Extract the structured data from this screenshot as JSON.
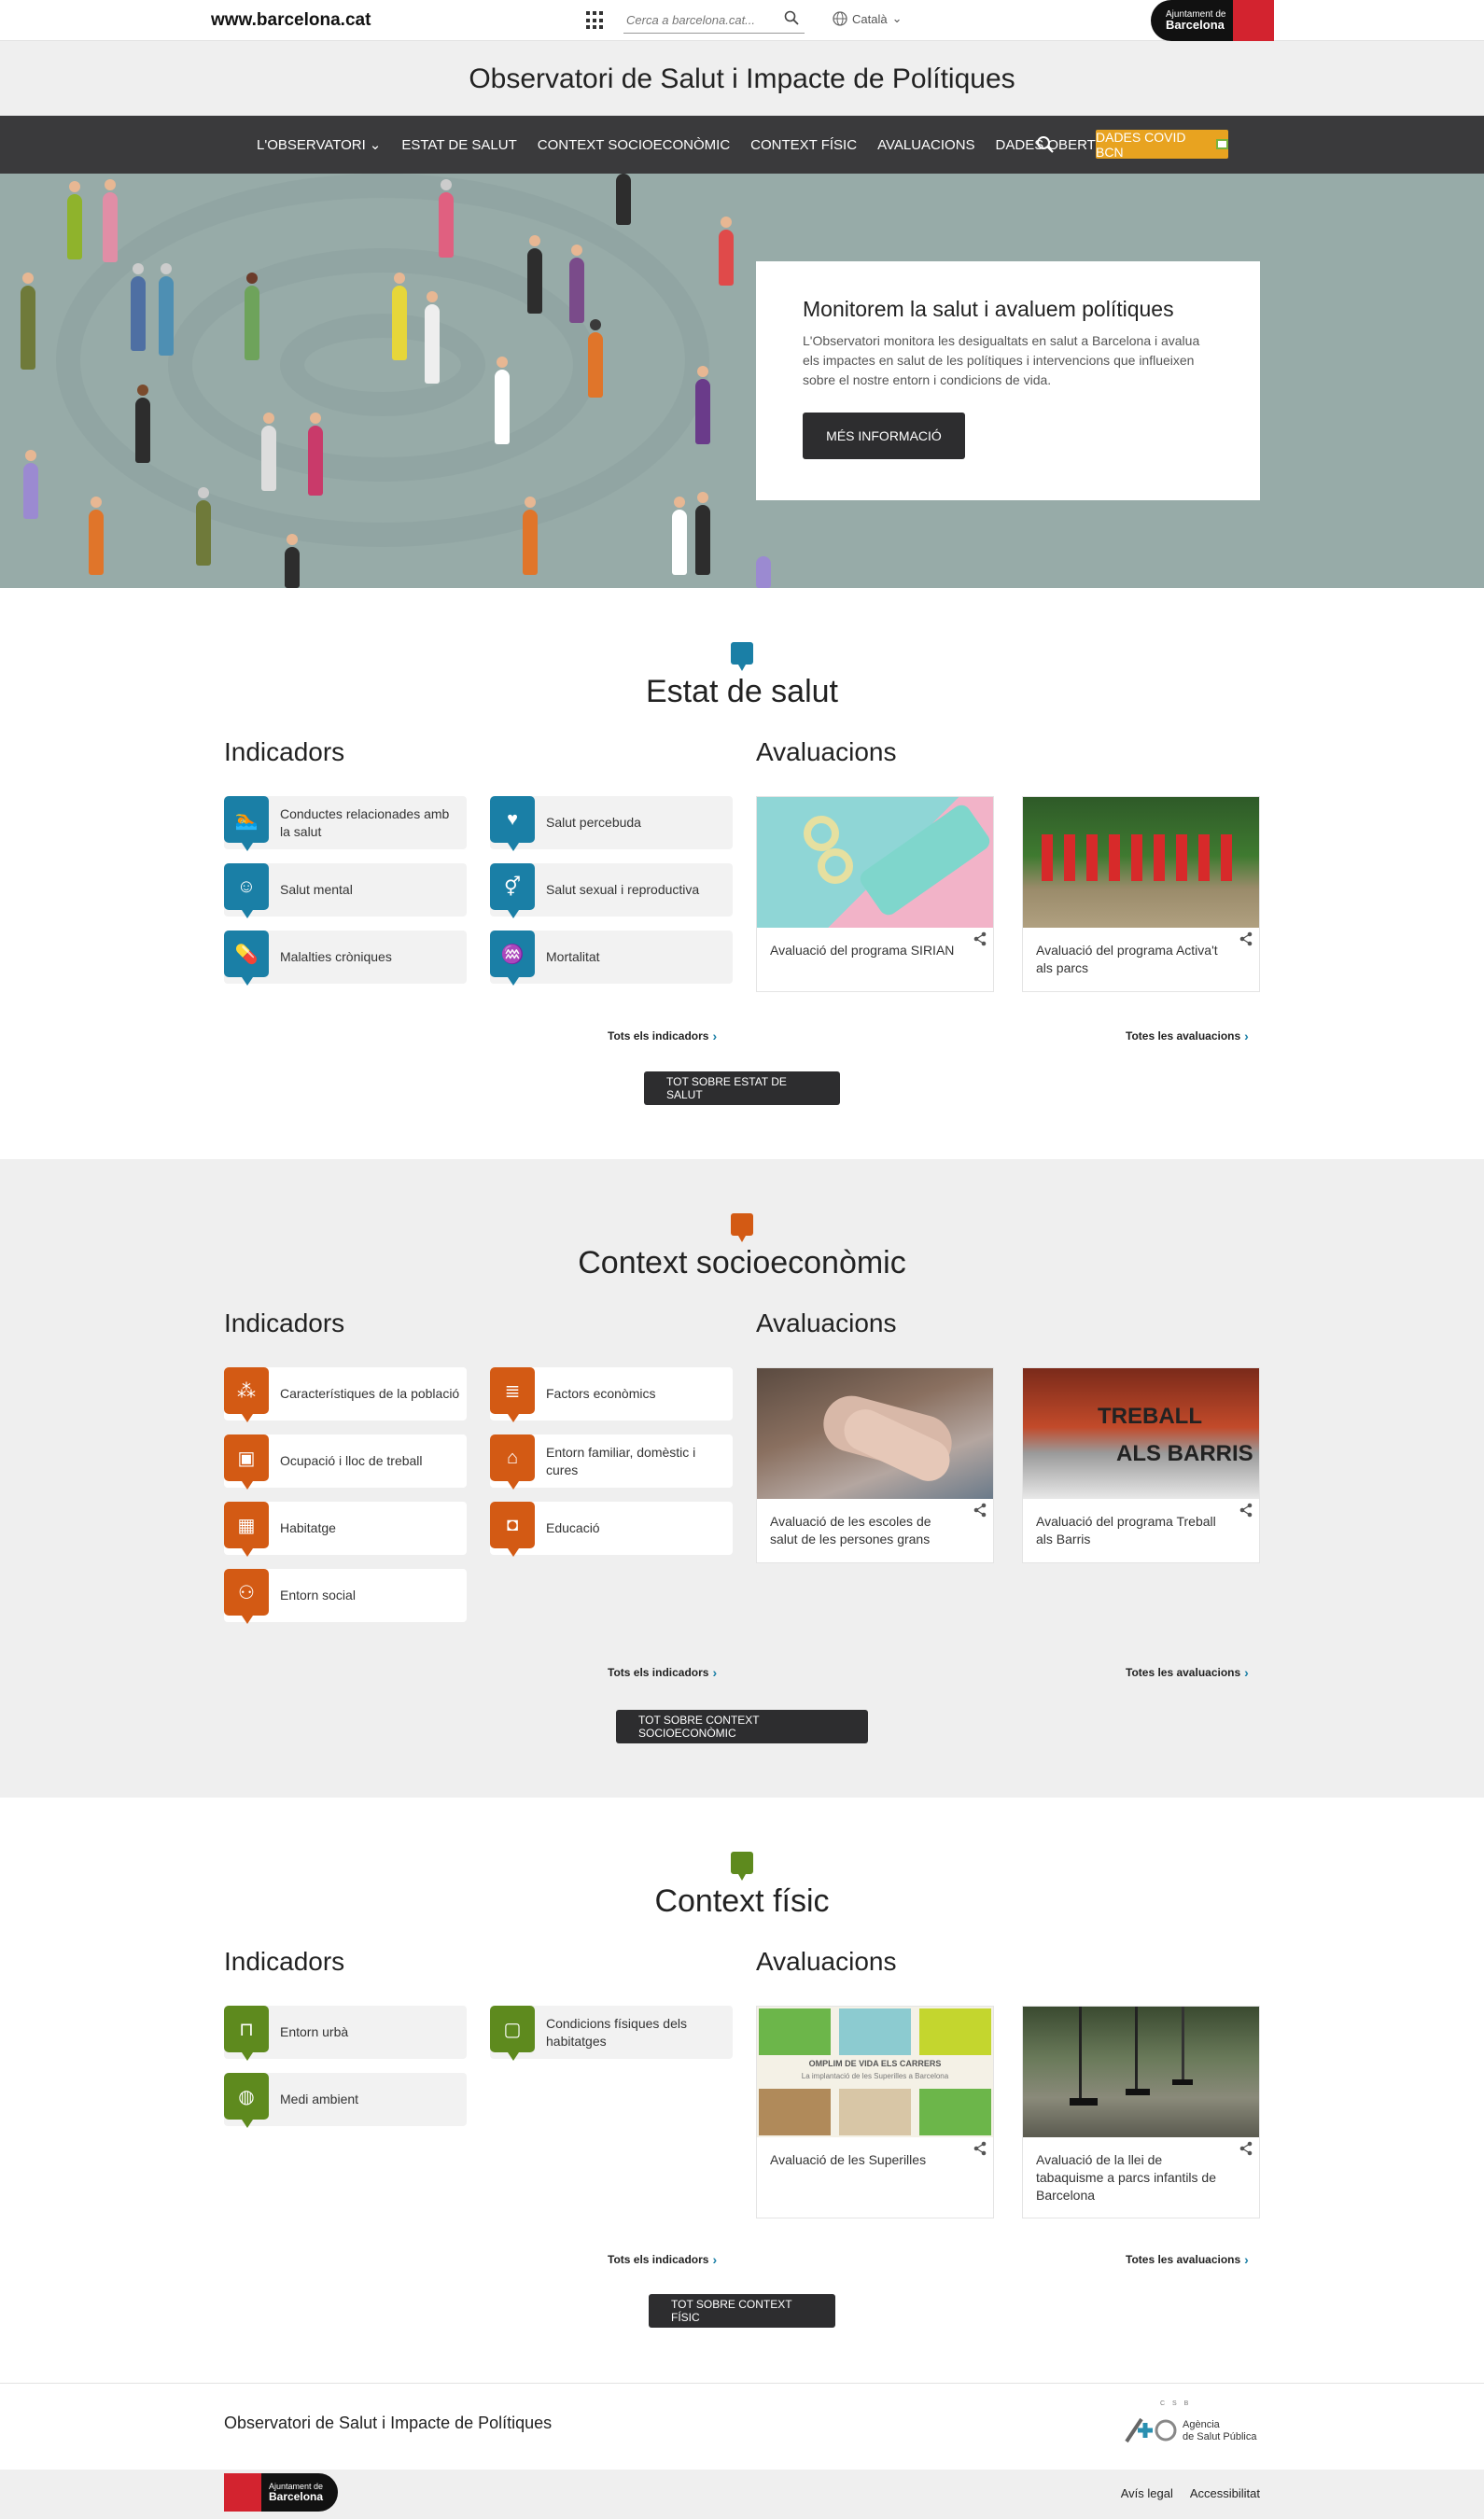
{
  "topbar": {
    "site_url": "www.barcelona.cat",
    "search_placeholder": "Cerca a barcelona.cat...",
    "language": "Català",
    "logo_line1": "Ajuntament de",
    "logo_line2": "Barcelona"
  },
  "site_title": "Observatori de Salut i Impacte de Polítiques",
  "nav": {
    "items": [
      "L'OBSERVATORI",
      "ESTAT DE SALUT",
      "CONTEXT SOCIOECONÒMIC",
      "CONTEXT FÍSIC",
      "AVALUACIONS",
      "DADES OBERTES"
    ],
    "covid_button": "DADES COVID BCN"
  },
  "hero": {
    "title": "Monitorem la salut i avaluem polítiques",
    "text": "L'Observatori monitora les desigualtats en salut a Barcelona i avalua els impactes en salut de les polítiques i intervencions que influeixen sobre el nostre entorn i condicions de vida.",
    "button": "MÉS INFORMACIÓ"
  },
  "colors": {
    "salut": "#1a7fa6",
    "socio": "#d35a14",
    "fisic": "#5e8a1e",
    "nav_bg": "#3a3a3c",
    "covid": "#e8a320"
  },
  "sections": [
    {
      "title": "Estat de salut",
      "indicators_title": "Indicadors",
      "evaluations_title": "Avaluacions",
      "indicators": [
        {
          "label": "Conductes relacionades amb la salut",
          "icon": "swimmer-icon"
        },
        {
          "label": "Salut percebuda",
          "icon": "heart-head-icon"
        },
        {
          "label": "Salut mental",
          "icon": "brain-head-icon"
        },
        {
          "label": "Salut sexual i reproductiva",
          "icon": "gender-icon"
        },
        {
          "label": "Malalties cròniques",
          "icon": "pills-icon"
        },
        {
          "label": "Mortalitat",
          "icon": "ecg-monitor-icon"
        }
      ],
      "evaluations": [
        {
          "label": "Avaluació del programa SIRIAN"
        },
        {
          "label": "Avaluació del programa Activa't als parcs"
        }
      ],
      "all_indicators": "Tots els indicadors",
      "all_evaluations": "Totes les avaluacions",
      "button": "TOT SOBRE ESTAT DE SALUT"
    },
    {
      "title": "Context socioeconòmic",
      "indicators_title": "Indicadors",
      "evaluations_title": "Avaluacions",
      "indicators": [
        {
          "label": "Característiques de la població",
          "icon": "population-pyramid-icon"
        },
        {
          "label": "Factors econòmics",
          "icon": "money-icon"
        },
        {
          "label": "Ocupació i lloc de treball",
          "icon": "briefcase-icon"
        },
        {
          "label": "Entorn familiar, domèstic i cures",
          "icon": "family-house-icon"
        },
        {
          "label": "Habitatge",
          "icon": "building-icon"
        },
        {
          "label": "Educació",
          "icon": "backpack-icon"
        },
        {
          "label": "Entorn social",
          "icon": "community-icon"
        }
      ],
      "evaluations": [
        {
          "label": "Avaluació de les escoles de salut de les persones grans"
        },
        {
          "label": "Avaluació del programa Treball als Barris"
        }
      ],
      "treball_image_text_1": "TREBALL",
      "treball_image_text_2": "ALS BARRIS",
      "all_indicators": "Tots els indicadors",
      "all_evaluations": "Totes les avaluacions",
      "button": "TOT SOBRE CONTEXT SOCIOECONÒMIC"
    },
    {
      "title": "Context físic",
      "indicators_title": "Indicadors",
      "evaluations_title": "Avaluacions",
      "indicators": [
        {
          "label": "Entorn urbà",
          "icon": "bench-icon"
        },
        {
          "label": "Condicions físiques dels habitatges",
          "icon": "window-icon"
        },
        {
          "label": "Medi ambient",
          "icon": "globe-icon"
        }
      ],
      "evaluations": [
        {
          "label": "Avaluació de les Superilles"
        },
        {
          "label": "Avaluació de la llei de tabaquisme a parcs infantils de Barcelona"
        }
      ],
      "superilles_image_text_1": "OMPLIM DE VIDA ELS CARRERS",
      "superilles_image_text_2": "La implantació de les Superilles a Barcelona",
      "all_indicators": "Tots els indicadors",
      "all_evaluations": "Totes les avaluacions",
      "button": "TOT SOBRE CONTEXT FÍSIC"
    }
  ],
  "footer": {
    "title": "Observatori de Salut i Impacte de Polítiques",
    "aspb_line1": "Agència",
    "aspb_line2": "de Salut Pública",
    "aspb_small": "C S B",
    "logo_line1": "Ajuntament de",
    "logo_line2": "Barcelona",
    "links": [
      "Avís legal",
      "Accessibilitat"
    ]
  }
}
